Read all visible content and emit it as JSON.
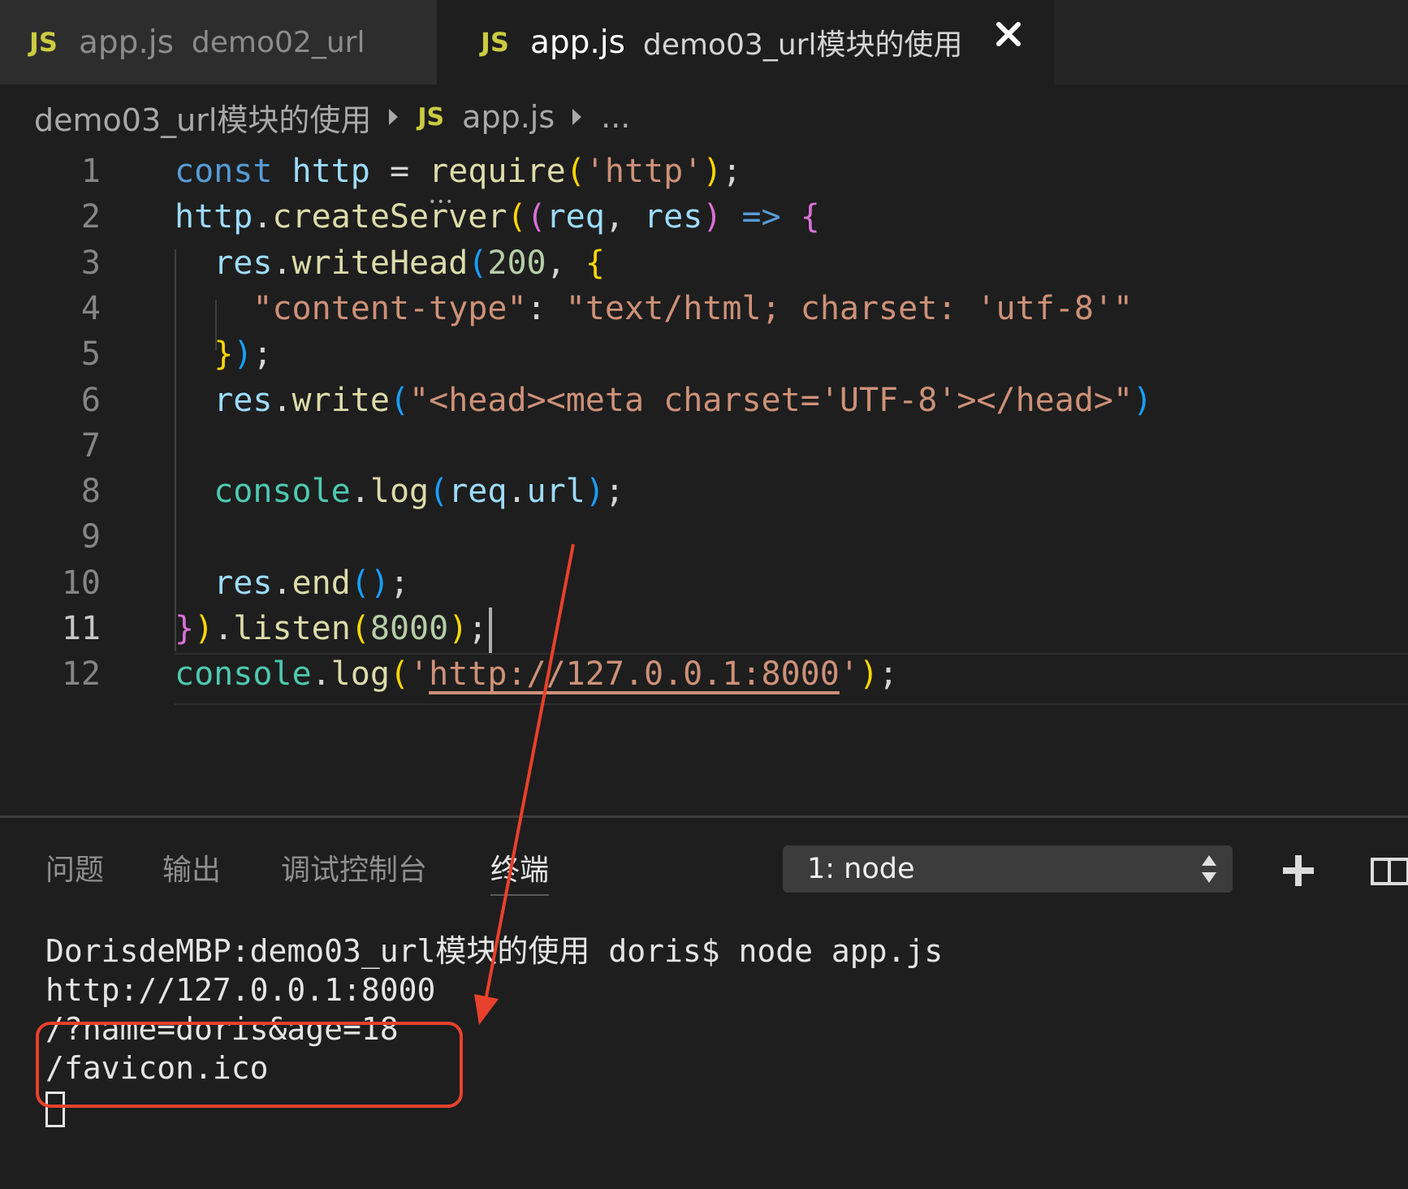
{
  "tabs": [
    {
      "badge": "JS",
      "name": "app.js",
      "dir": "demo02_url",
      "active": false
    },
    {
      "badge": "JS",
      "name": "app.js",
      "dir": "demo03_url模块的使用",
      "active": true
    }
  ],
  "breadcrumb": {
    "folder": "demo03_url模块的使用",
    "badge": "JS",
    "file": "app.js",
    "more": "..."
  },
  "editor": {
    "active_line": 11,
    "lines": [
      {
        "n": "1",
        "text": "const http = require('http');"
      },
      {
        "n": "2",
        "text": "http.createServer((req, res) => {"
      },
      {
        "n": "3",
        "text": "  res.writeHead(200, {"
      },
      {
        "n": "4",
        "text": "    \"content-type\": \"text/html; charset: 'utf-8'\""
      },
      {
        "n": "5",
        "text": "  });"
      },
      {
        "n": "6",
        "text": "  res.write(\"<head><meta charset='UTF-8'></head>\")"
      },
      {
        "n": "7",
        "text": ""
      },
      {
        "n": "8",
        "text": "  console.log(req.url);"
      },
      {
        "n": "9",
        "text": ""
      },
      {
        "n": "10",
        "text": "  res.end();"
      },
      {
        "n": "11",
        "text": "}).listen(8000);"
      },
      {
        "n": "12",
        "text": "console.log('http://127.0.0.1:8000');"
      }
    ]
  },
  "panel": {
    "tabs": [
      "问题",
      "输出",
      "调试控制台",
      "终端"
    ],
    "active_tab": "终端",
    "terminal_select": "1: node",
    "terminal_lines": [
      "DorisdeMBP:demo03_url模块的使用 doris$ node app.js",
      "http://127.0.0.1:8000",
      "/?name=doris&age=18",
      "/favicon.ico"
    ]
  },
  "colors": {
    "annotation": "#e8412c",
    "js_badge": "#cbcb41"
  }
}
